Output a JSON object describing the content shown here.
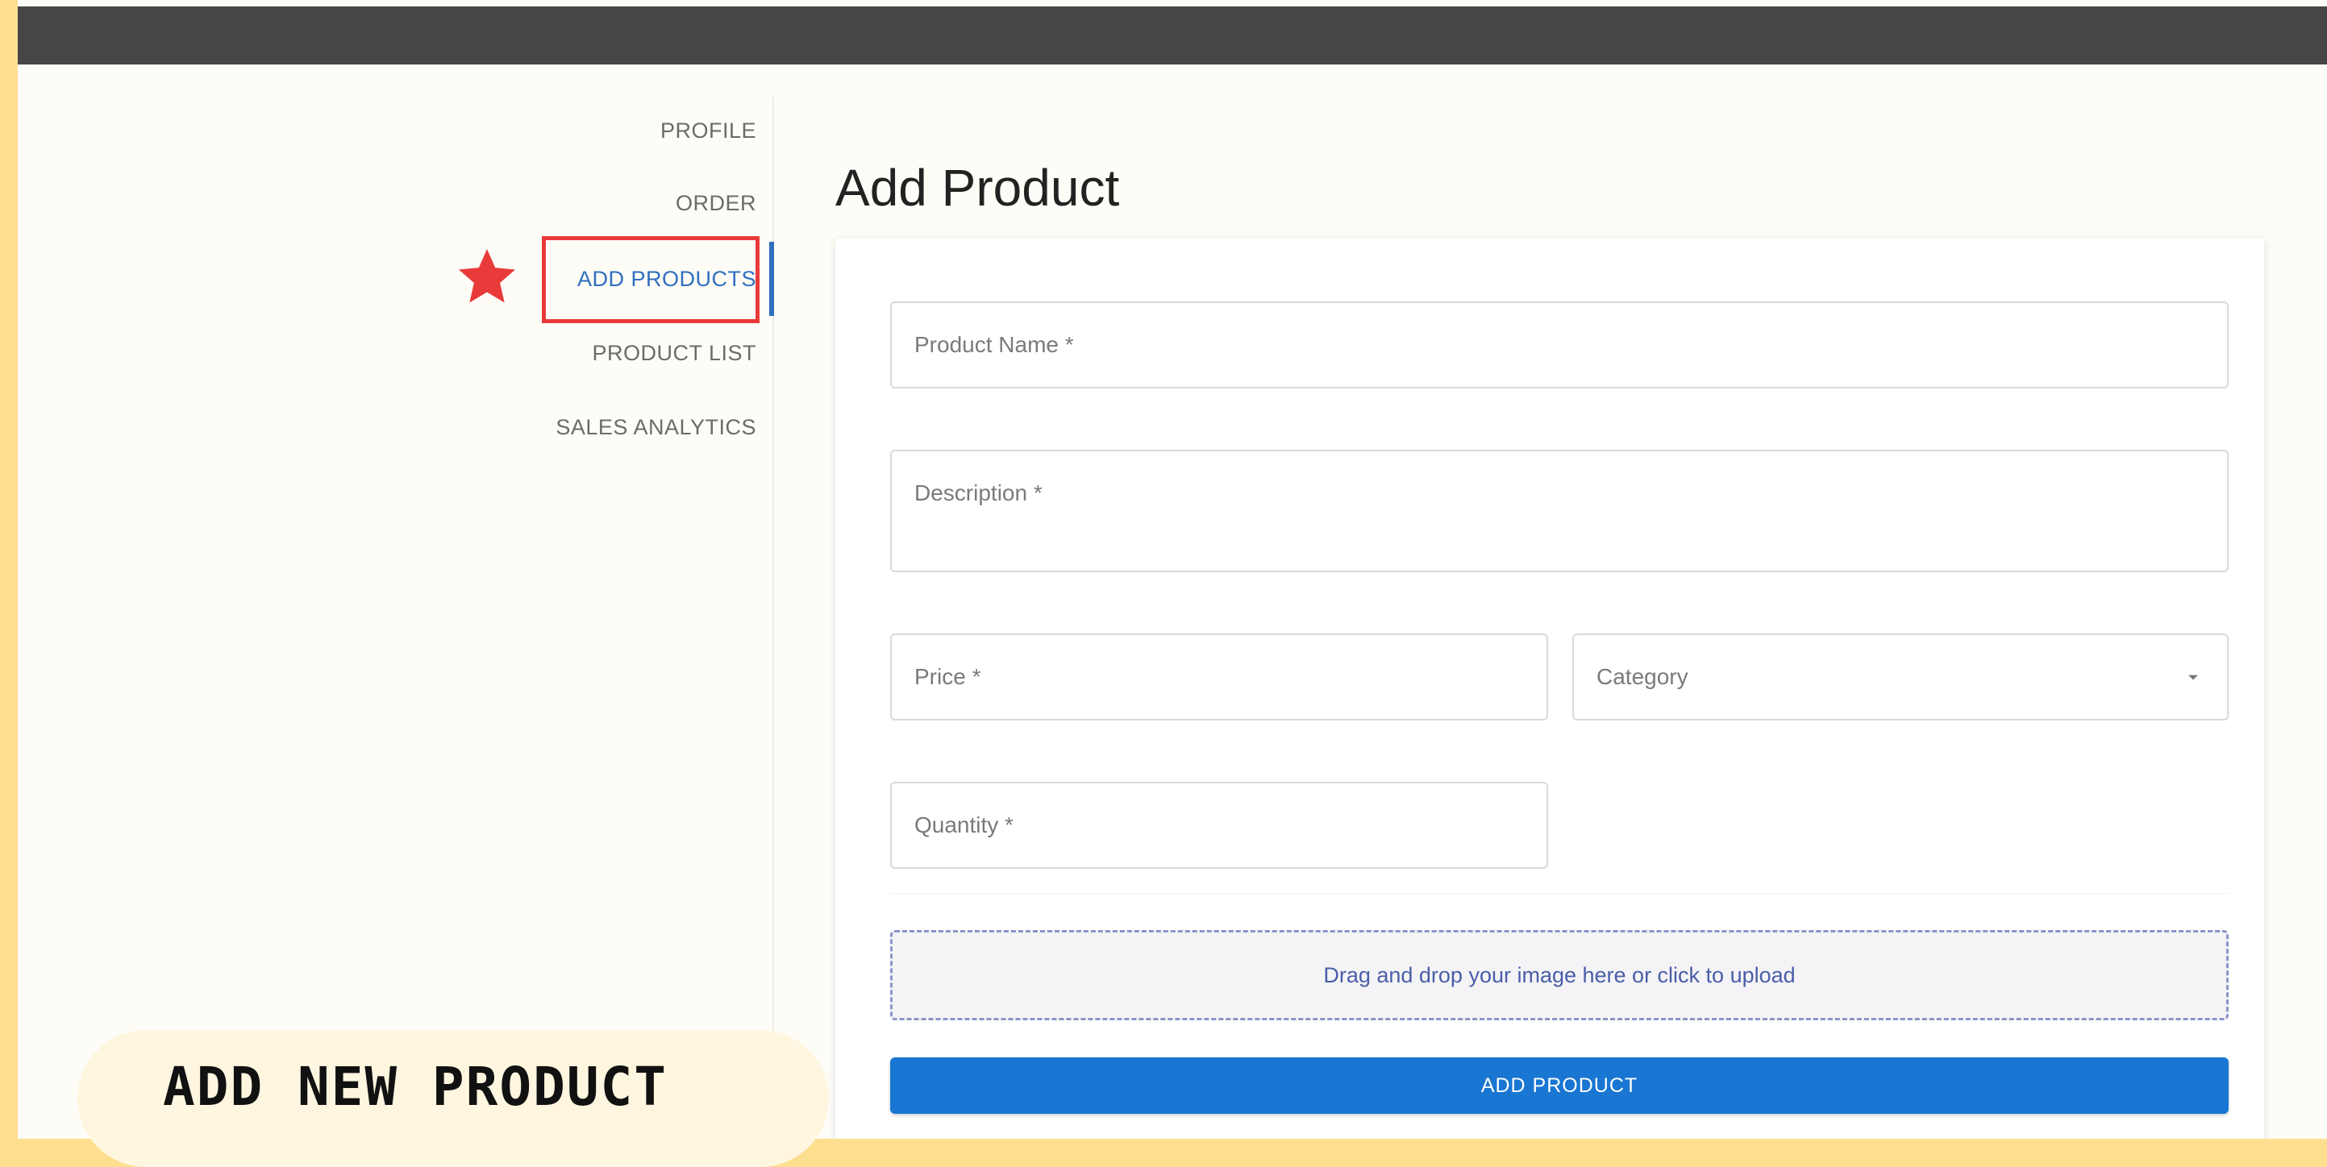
{
  "sidebar": {
    "items": [
      {
        "label": "PROFILE",
        "active": false
      },
      {
        "label": "ORDER",
        "active": false
      },
      {
        "label": "ADD PRODUCTS",
        "active": true
      },
      {
        "label": "PRODUCT LIST",
        "active": false
      },
      {
        "label": "SALES ANALYTICS",
        "active": false
      }
    ]
  },
  "main": {
    "title": "Add Product",
    "form": {
      "product_name_placeholder": "Product Name *",
      "description_placeholder": "Description *",
      "price_placeholder": "Price *",
      "category_label": "Category",
      "quantity_placeholder": "Quantity *",
      "dropzone_text": "Drag and drop your image here or click to upload",
      "submit_label": "ADD PRODUCT"
    }
  },
  "annotation": {
    "caption": "ADD NEW PRODUCT",
    "highlight_color": "#E93A3A",
    "star_icon": "star-icon"
  },
  "colors": {
    "accent": "#1976D2",
    "frame": "#FEDF8F",
    "topbar": "#464646"
  }
}
